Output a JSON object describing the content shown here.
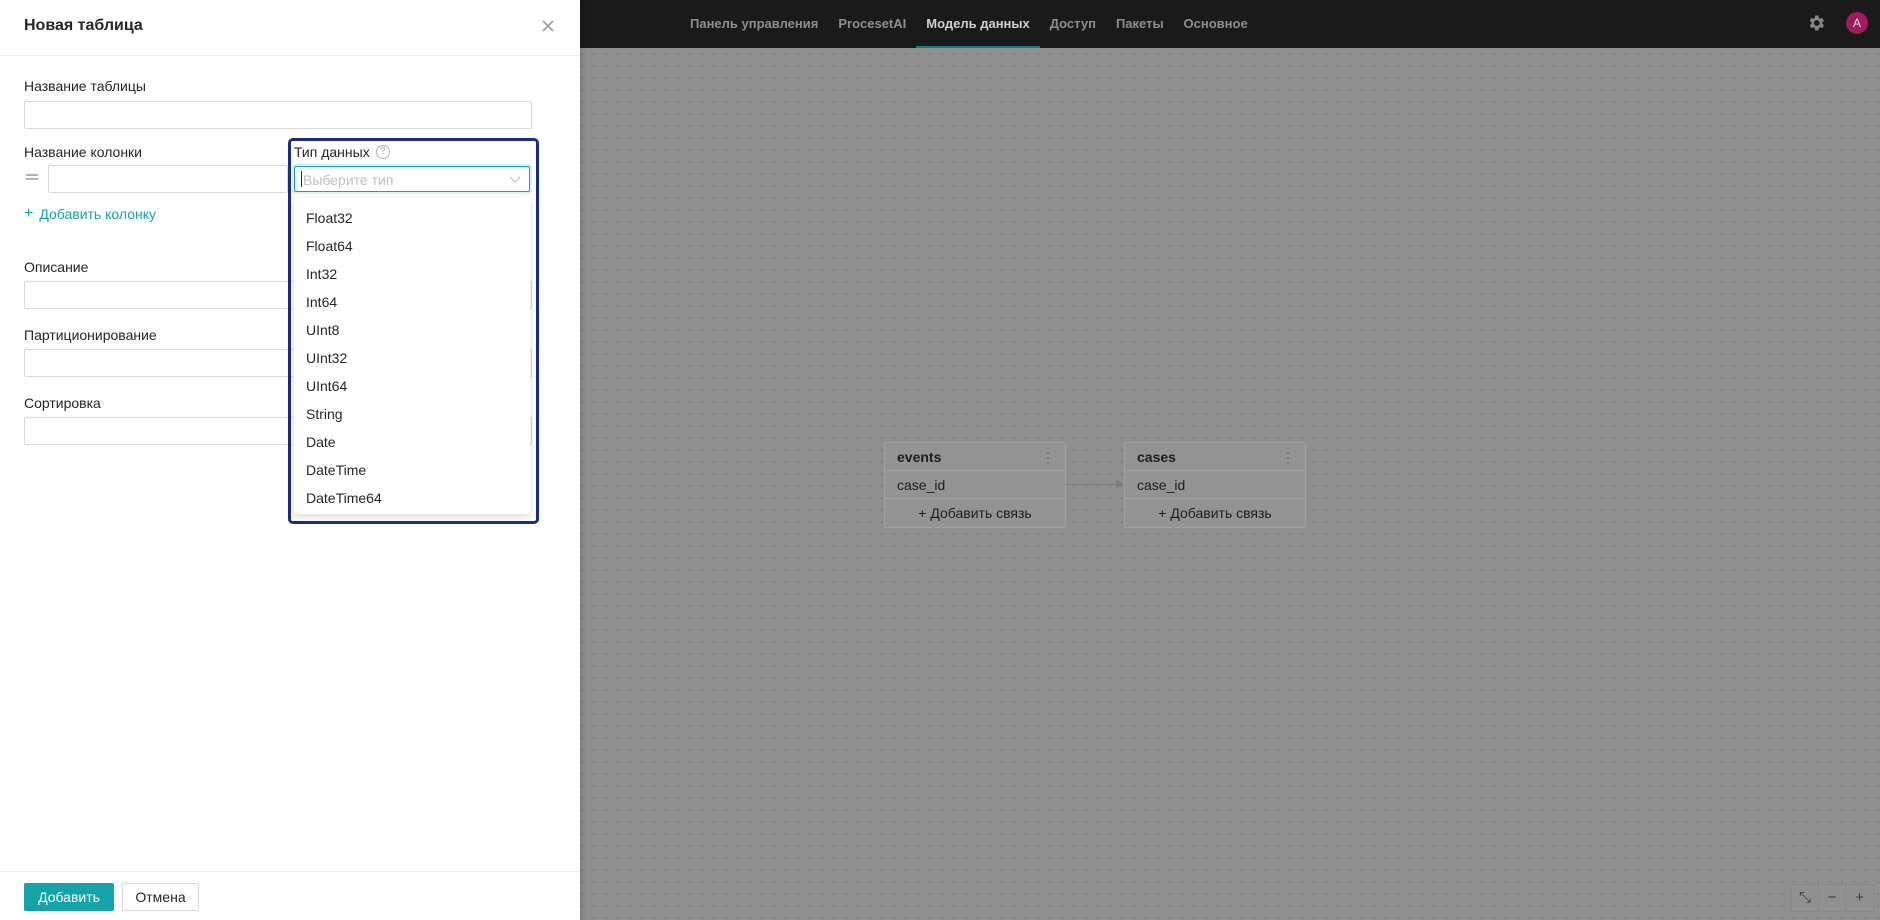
{
  "nav": {
    "items": [
      "Панель управления",
      "ProcesetAI",
      "Модель данных",
      "Доступ",
      "Пакеты",
      "Основное"
    ],
    "active_index": 2,
    "avatar_letter": "A"
  },
  "canvas": {
    "tables": [
      {
        "name": "events",
        "rows": [
          "case_id"
        ],
        "add_link": "Добавить связь"
      },
      {
        "name": "cases",
        "rows": [
          "case_id"
        ],
        "add_link": "Добавить связь"
      }
    ],
    "zoom_controls": [
      "fit-icon",
      "zoom-out-icon",
      "zoom-in-icon"
    ]
  },
  "drawer": {
    "title": "Новая таблица",
    "table_name_label": "Название таблицы",
    "table_name_value": "",
    "column_name_label": "Название колонки",
    "column_name_value": "",
    "data_type_label": "Тип данных",
    "data_type_placeholder": "Выберите тип",
    "add_column": "Добавить колонку",
    "description_label": "Описание",
    "partitioning_label": "Партиционирование",
    "sorting_label": "Сортировка",
    "submit": "Добавить",
    "cancel": "Отмена"
  },
  "dropdown": {
    "options": [
      "Float32",
      "Float64",
      "Int32",
      "Int64",
      "UInt8",
      "UInt32",
      "UInt64",
      "String",
      "Date",
      "DateTime",
      "DateTime64"
    ]
  },
  "colors": {
    "accent": "#14a3a8",
    "highlight_border": "#1a2e7e",
    "avatar": "#9e1b5e"
  }
}
